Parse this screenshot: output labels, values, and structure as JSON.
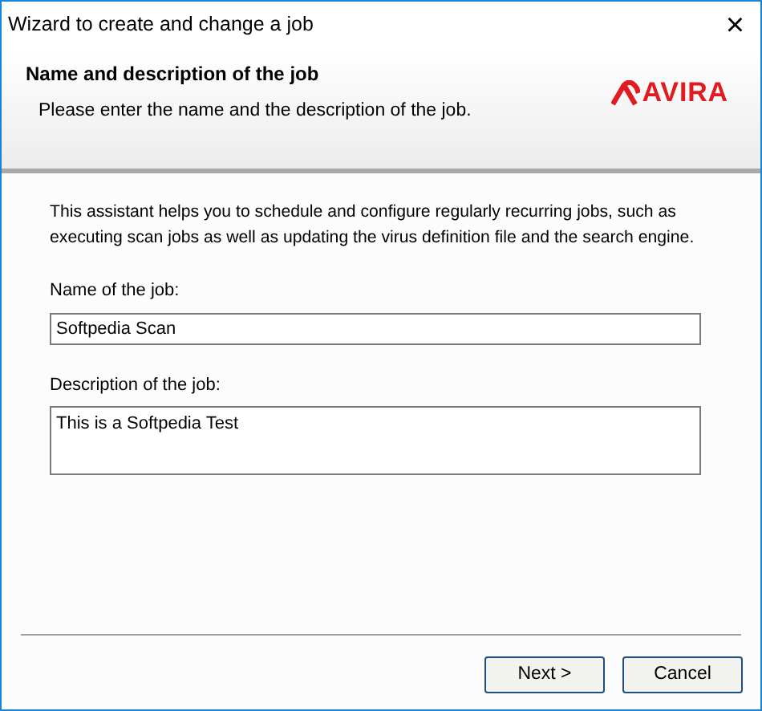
{
  "window": {
    "title": "Wizard to create and change a job",
    "close": "×"
  },
  "header": {
    "title": "Name and description of the job",
    "subtitle": "Please enter the name and the description of the job.",
    "logo_text": "AVIRA"
  },
  "intro": "This assistant helps you to schedule and configure regularly recurring jobs, such as executing scan jobs as well as updating the virus definition file and the search engine.",
  "fields": [
    {
      "label": "Name of the job:",
      "value": "Softpedia Scan",
      "kind": "line"
    },
    {
      "label": "Description of the job:",
      "value": "This is a Softpedia Test",
      "kind": "multiline"
    }
  ],
  "buttons": [
    "Next >",
    "Cancel"
  ]
}
